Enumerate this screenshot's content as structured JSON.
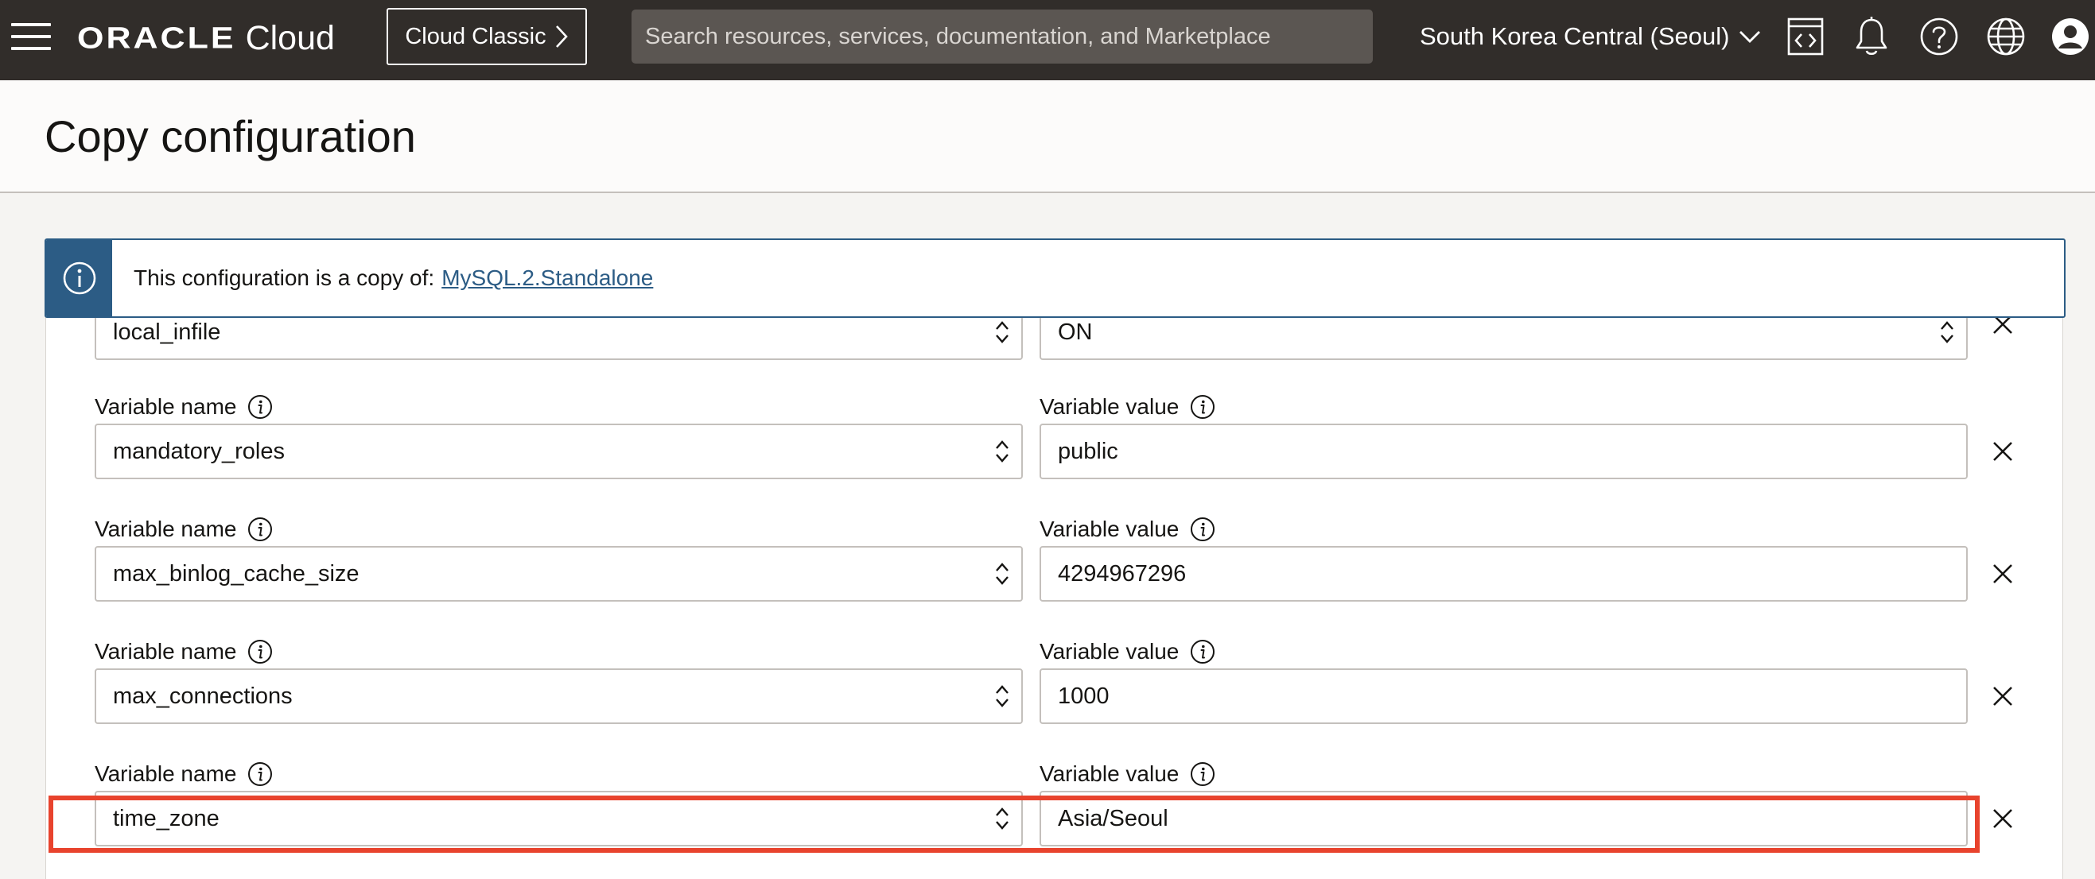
{
  "topbar": {
    "brand_primary": "ORACLE",
    "brand_secondary": "Cloud",
    "classic_button_label": "Cloud Classic",
    "search_placeholder": "Search resources, services, documentation, and Marketplace",
    "region_label": "South Korea Central (Seoul)",
    "icons": [
      "menu-icon",
      "chevron-right-icon",
      "chevron-down-icon",
      "code-editor-icon",
      "bell-icon",
      "help-icon",
      "globe-icon",
      "user-profile-icon"
    ]
  },
  "page": {
    "title": "Copy configuration"
  },
  "banner": {
    "text": "This configuration is a copy of:",
    "link_text": "MySQL.2.Standalone",
    "icon": "info-icon"
  },
  "variables": {
    "name_label": "Variable name",
    "value_label": "Variable value",
    "rows": [
      {
        "name": "local_infile",
        "value": "ON"
      },
      {
        "name": "mandatory_roles",
        "value": "public"
      },
      {
        "name": "max_binlog_cache_size",
        "value": "4294967296"
      },
      {
        "name": "max_connections",
        "value": "1000"
      },
      {
        "name": "time_zone",
        "value": "Asia/Seoul"
      }
    ]
  },
  "colors": {
    "topbar_bg": "#312d2a",
    "search_bg": "#5b5652",
    "banner_accent": "#2c5c85",
    "link": "#2c5c85",
    "highlight": "#e8432d",
    "page_bg": "#f5f4f2"
  }
}
